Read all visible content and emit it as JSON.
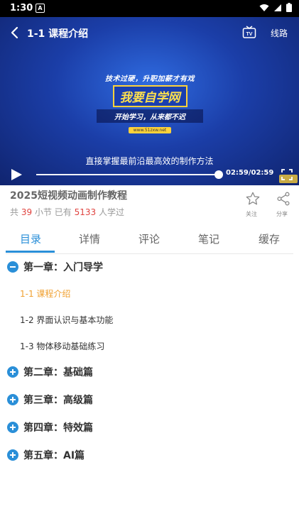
{
  "status": {
    "time": "1:30",
    "notif_letter": "A"
  },
  "player": {
    "title": "1-1 课程介绍",
    "tv_label": "TV",
    "route_label": "线路",
    "promo_slogan1": "技术过硬，升职加薪才有戏",
    "promo_brand": "我要自学网",
    "promo_slogan2": "开始学习，从来都不迟",
    "promo_url": "www.51zxw.net",
    "caption": "直接掌握最前沿最高效的制作方法",
    "time_display": "02:59/02:59",
    "progress": 1.0
  },
  "course": {
    "title": "2025短视频动画制作教程",
    "stats_prefix": "共",
    "lesson_count": "39",
    "stats_mid": "小节  已有",
    "learner_count": "5133",
    "stats_suffix": "人学过",
    "favorite_label": "关注",
    "share_label": "分享"
  },
  "tabs": [
    "目录",
    "详情",
    "评论",
    "笔记",
    "缓存"
  ],
  "catalog": {
    "chapters": [
      {
        "label": "第一章：入门导学",
        "expanded": true,
        "lessons": [
          "1-1 课程介绍",
          "1-2 界面认识与基本功能",
          "1-3 物体移动基础练习"
        ]
      },
      {
        "label": "第二章：基础篇",
        "expanded": false
      },
      {
        "label": "第三章：高级篇",
        "expanded": false
      },
      {
        "label": "第四章：特效篇",
        "expanded": false
      },
      {
        "label": "第五章：AI篇",
        "expanded": false
      }
    ]
  },
  "colors": {
    "accent": "#2a8fd8",
    "current_lesson": "#f0a030",
    "count_red": "#e0433f"
  }
}
